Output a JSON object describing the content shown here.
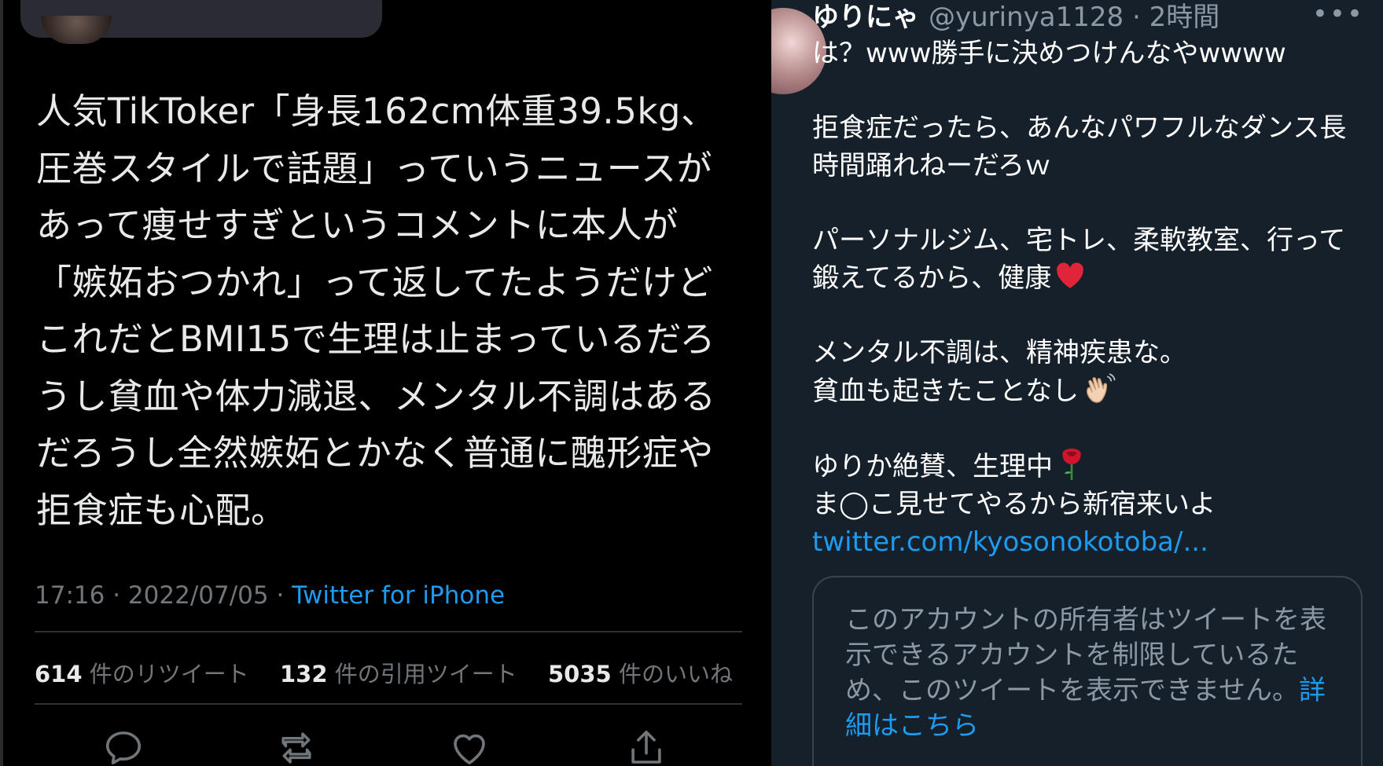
{
  "left": {
    "tweet_lines": [
      "人気TikToker「身長162cm体重39.5kg、",
      "圧巻スタイルで話題」っていうニュースが",
      "あって痩せすぎというコメントに本人が",
      "「嫉妬おつかれ」って返してたようだけど",
      "これだとBMI15で生理は止まっているだろ",
      "うし貧血や体力減退、メンタル不調はある",
      "だろうし全然嫉妬とかなく普通に醜形症や",
      "拒食症も心配。"
    ],
    "time": "17:16",
    "date": "2022/07/05",
    "source": "Twitter for iPhone",
    "stats": {
      "retweets_count": "614",
      "retweets_label": "件のリツイート",
      "quotes_count": "132",
      "quotes_label": "件の引用ツイート",
      "likes_count": "5035",
      "likes_label": "件のいいね"
    },
    "actions": {
      "reply_icon": "reply-icon",
      "retweet_icon": "retweet-icon",
      "like_icon": "heart-icon",
      "share_icon": "share-icon"
    }
  },
  "right": {
    "display_name": "ゆりにゃ",
    "handle": "@yurinya1128",
    "time_ago": "2時間",
    "more": "•••",
    "lines": {
      "l1": "は？www勝手に決めつけんなやwwww",
      "l2": "拒食症だったら、あんなパワフルなダンス長",
      "l3": "時間踊れねーだろｗ",
      "l4": "パーソナルジム、宅トレ、柔軟教室、行って",
      "l5": "鍛えてるから、健康",
      "l6": "メンタル不調は、精神疾患な。",
      "l7": "貧血も起きたことなし",
      "l8": "ゆりか絶賛、生理中",
      "l9": "ま◯こ見せてやるから新宿来いよ",
      "link": "twitter.com/kyosonokotoba/..."
    },
    "emoji": {
      "heart": "red-heart-emoji",
      "wave": "waving-hand-emoji",
      "rose": "rose-emoji"
    },
    "card": {
      "text": "このアカウントの所有者はツイートを表示できるアカウントを制限しているため、このツイートを表示できません。",
      "link": "詳細はこちら"
    }
  },
  "colors": {
    "left_bg": "#000000",
    "right_bg": "#15202b",
    "link": "#1d9bf0",
    "muted": "#71767b"
  }
}
